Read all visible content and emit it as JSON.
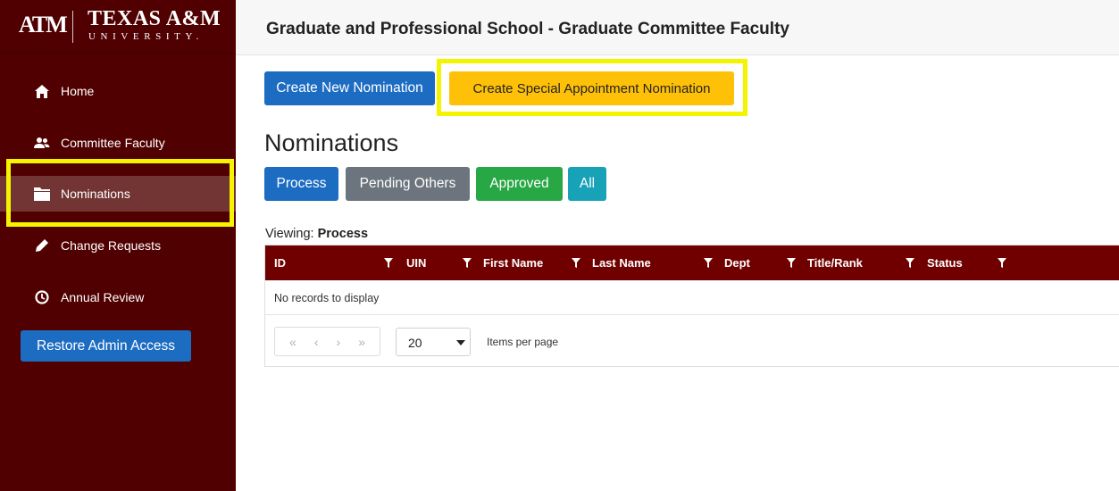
{
  "brand": {
    "mark": "ATM",
    "name": "TEXAS A&M",
    "sub": "UNIVERSITY."
  },
  "header": {
    "title": "Graduate and Professional School - Graduate Committee Faculty"
  },
  "sidebar": {
    "items": [
      {
        "label": "Home",
        "icon": "home-icon"
      },
      {
        "label": "Committee Faculty",
        "icon": "users-icon"
      },
      {
        "label": "Nominations",
        "icon": "folder-icon",
        "active": true
      },
      {
        "label": "Change Requests",
        "icon": "pencil-icon"
      },
      {
        "label": "Annual Review",
        "icon": "clock-icon"
      }
    ],
    "restore_label": "Restore Admin Access"
  },
  "actions": {
    "create_new": "Create New Nomination",
    "create_special": "Create Special Appointment Nomination"
  },
  "page": {
    "title": "Nominations"
  },
  "filters": {
    "process": "Process",
    "pending": "Pending Others",
    "approved": "Approved",
    "all": "All"
  },
  "viewing": {
    "prefix": "Viewing: ",
    "value": "Process"
  },
  "grid": {
    "columns": [
      "ID",
      "UIN",
      "First Name",
      "Last Name",
      "Dept",
      "Title/Rank",
      "Status"
    ],
    "empty_text": "No records to display",
    "page_size": "20",
    "page_size_label": "Items per page"
  },
  "colors": {
    "maroon": "#500000",
    "header_maroon": "#700000",
    "primary": "#1c6cc2",
    "warning": "#ffc107",
    "success": "#28a745",
    "info": "#17a2b8",
    "secondary": "#6c757d",
    "highlight": "#f4f400"
  }
}
